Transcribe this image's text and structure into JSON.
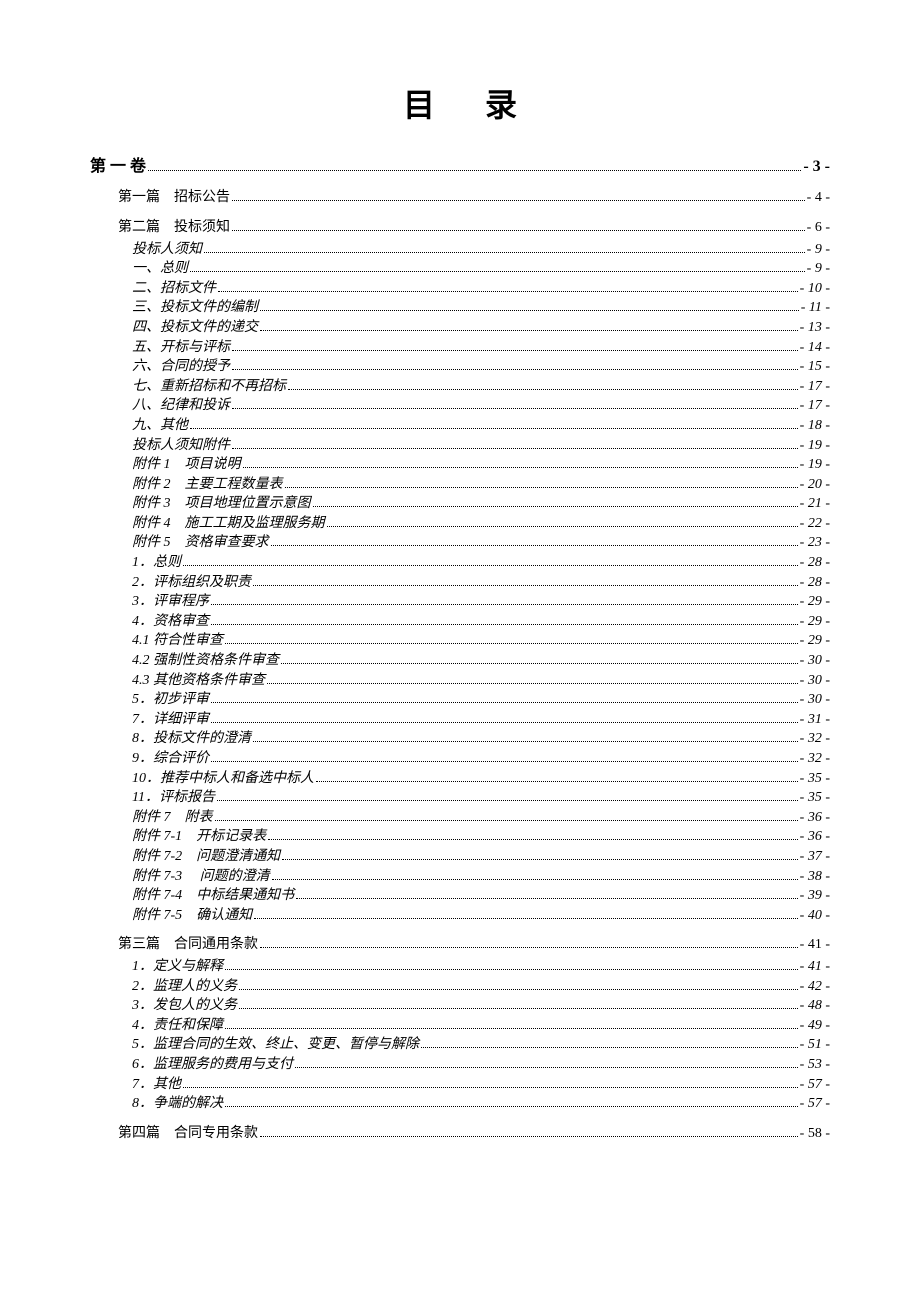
{
  "title": "目录",
  "entries": [
    {
      "label": "第 一 卷",
      "page": "- 3 -",
      "level": 0,
      "bold": true,
      "italic": false
    },
    {
      "label": "第一篇　招标公告",
      "page": "- 4 -",
      "level": 1,
      "bold": false,
      "italic": false
    },
    {
      "label": "第二篇　投标须知",
      "page": "- 6 -",
      "level": 1,
      "bold": false,
      "italic": false
    },
    {
      "label": "投标人须知",
      "page": "- 9 -",
      "level": 2,
      "bold": false,
      "italic": true
    },
    {
      "label": "一、总则",
      "page": "- 9 -",
      "level": 2,
      "bold": false,
      "italic": true
    },
    {
      "label": "二、招标文件",
      "page": "- 10 -",
      "level": 2,
      "bold": false,
      "italic": true
    },
    {
      "label": "三、投标文件的编制",
      "page": "- 11 -",
      "level": 2,
      "bold": false,
      "italic": true
    },
    {
      "label": "四、投标文件的递交",
      "page": "- 13 -",
      "level": 2,
      "bold": false,
      "italic": true
    },
    {
      "label": "五、开标与评标",
      "page": "- 14 -",
      "level": 2,
      "bold": false,
      "italic": true
    },
    {
      "label": "六、合同的授予",
      "page": "- 15 -",
      "level": 2,
      "bold": false,
      "italic": true
    },
    {
      "label": "七、重新招标和不再招标",
      "page": "- 17 -",
      "level": 2,
      "bold": false,
      "italic": true
    },
    {
      "label": "八、纪律和投诉",
      "page": "- 17 -",
      "level": 2,
      "bold": false,
      "italic": true
    },
    {
      "label": "九、其他",
      "page": "- 18 -",
      "level": 2,
      "bold": false,
      "italic": true
    },
    {
      "label": "投标人须知附件",
      "page": "- 19 -",
      "level": 2,
      "bold": false,
      "italic": true
    },
    {
      "label": "附件 1　项目说明",
      "page": "- 19 -",
      "level": 2,
      "bold": false,
      "italic": true
    },
    {
      "label": "附件 2　主要工程数量表",
      "page": "- 20 -",
      "level": 2,
      "bold": false,
      "italic": true
    },
    {
      "label": "附件 3　项目地理位置示意图",
      "page": "- 21 -",
      "level": 2,
      "bold": false,
      "italic": true
    },
    {
      "label": "附件 4　施工工期及监理服务期",
      "page": "- 22 -",
      "level": 2,
      "bold": false,
      "italic": true
    },
    {
      "label": "附件 5　资格审查要求",
      "page": "- 23 -",
      "level": 2,
      "bold": false,
      "italic": true
    },
    {
      "label": "1．总则",
      "page": "- 28 -",
      "level": 2,
      "bold": false,
      "italic": true
    },
    {
      "label": "2．评标组织及职责",
      "page": "- 28 -",
      "level": 2,
      "bold": false,
      "italic": true
    },
    {
      "label": "3．评审程序",
      "page": "- 29 -",
      "level": 2,
      "bold": false,
      "italic": true
    },
    {
      "label": "4．资格审查",
      "page": "- 29 -",
      "level": 2,
      "bold": false,
      "italic": true
    },
    {
      "label": "4.1 符合性审查",
      "page": "- 29 -",
      "level": 2,
      "bold": false,
      "italic": true
    },
    {
      "label": "4.2 强制性资格条件审查",
      "page": "- 30 -",
      "level": 2,
      "bold": false,
      "italic": true
    },
    {
      "label": "4.3 其他资格条件审查",
      "page": "- 30 -",
      "level": 2,
      "bold": false,
      "italic": true
    },
    {
      "label": "5．初步评审",
      "page": "- 30 -",
      "level": 2,
      "bold": false,
      "italic": true
    },
    {
      "label": "7．详细评审",
      "page": "- 31 -",
      "level": 2,
      "bold": false,
      "italic": true
    },
    {
      "label": "8．投标文件的澄清",
      "page": "- 32 -",
      "level": 2,
      "bold": false,
      "italic": true
    },
    {
      "label": "9．综合评价",
      "page": "- 32 -",
      "level": 2,
      "bold": false,
      "italic": true
    },
    {
      "label": "10．推荐中标人和备选中标人",
      "page": "- 35 -",
      "level": 2,
      "bold": false,
      "italic": true
    },
    {
      "label": "11．评标报告",
      "page": "- 35 -",
      "level": 2,
      "bold": false,
      "italic": true
    },
    {
      "label": "附件 7　附表",
      "page": "- 36 -",
      "level": 2,
      "bold": false,
      "italic": true
    },
    {
      "label": "附件 7-1　开标记录表",
      "page": "- 36 -",
      "level": 2,
      "bold": false,
      "italic": true
    },
    {
      "label": "附件 7-2　问题澄清通知",
      "page": "- 37 -",
      "level": 2,
      "bold": false,
      "italic": true
    },
    {
      "label": "附件 7-3　 问题的澄清",
      "page": "- 38 -",
      "level": 2,
      "bold": false,
      "italic": true
    },
    {
      "label": "附件 7-4　中标结果通知书",
      "page": "- 39 -",
      "level": 2,
      "bold": false,
      "italic": true
    },
    {
      "label": "附件 7-5　确认通知",
      "page": "- 40 -",
      "level": 2,
      "bold": false,
      "italic": true
    },
    {
      "label": "第三篇　合同通用条款",
      "page": "- 41 -",
      "level": 1,
      "bold": false,
      "italic": false
    },
    {
      "label": "1．定义与解释",
      "page": "- 41 -",
      "level": 2,
      "bold": false,
      "italic": true
    },
    {
      "label": "2．监理人的义务",
      "page": "- 42 -",
      "level": 2,
      "bold": false,
      "italic": true
    },
    {
      "label": "3．发包人的义务",
      "page": "- 48 -",
      "level": 2,
      "bold": false,
      "italic": true
    },
    {
      "label": "4．责任和保障",
      "page": "- 49 -",
      "level": 2,
      "bold": false,
      "italic": true
    },
    {
      "label": "5．监理合同的生效、终止、变更、暂停与解除",
      "page": "- 51 -",
      "level": 2,
      "bold": false,
      "italic": true
    },
    {
      "label": "6．监理服务的费用与支付",
      "page": "- 53 -",
      "level": 2,
      "bold": false,
      "italic": true
    },
    {
      "label": "7．其他",
      "page": "- 57 -",
      "level": 2,
      "bold": false,
      "italic": true
    },
    {
      "label": "8．争端的解决",
      "page": "- 57 -",
      "level": 2,
      "bold": false,
      "italic": true
    },
    {
      "label": "第四篇　合同专用条款",
      "page": "- 58 -",
      "level": 1,
      "bold": false,
      "italic": false
    }
  ]
}
